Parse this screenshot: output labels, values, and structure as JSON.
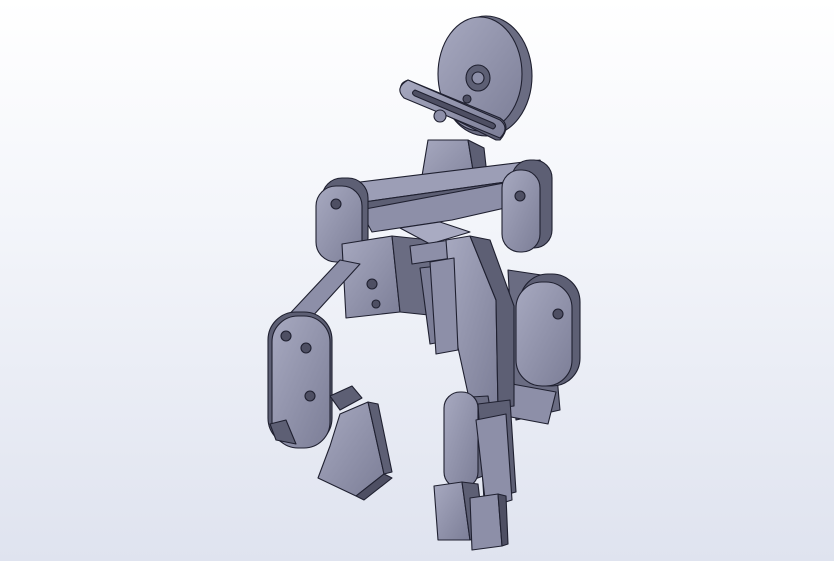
{
  "scene": {
    "model_name_shown": "",
    "part_color": "#8d8fa8",
    "part_color_dark": "#4e4f63",
    "part_color_light": "#a9abc2",
    "edge_color": "#1f2030",
    "background_top": "#ffffff",
    "background_bottom": "#dfe3ef"
  }
}
